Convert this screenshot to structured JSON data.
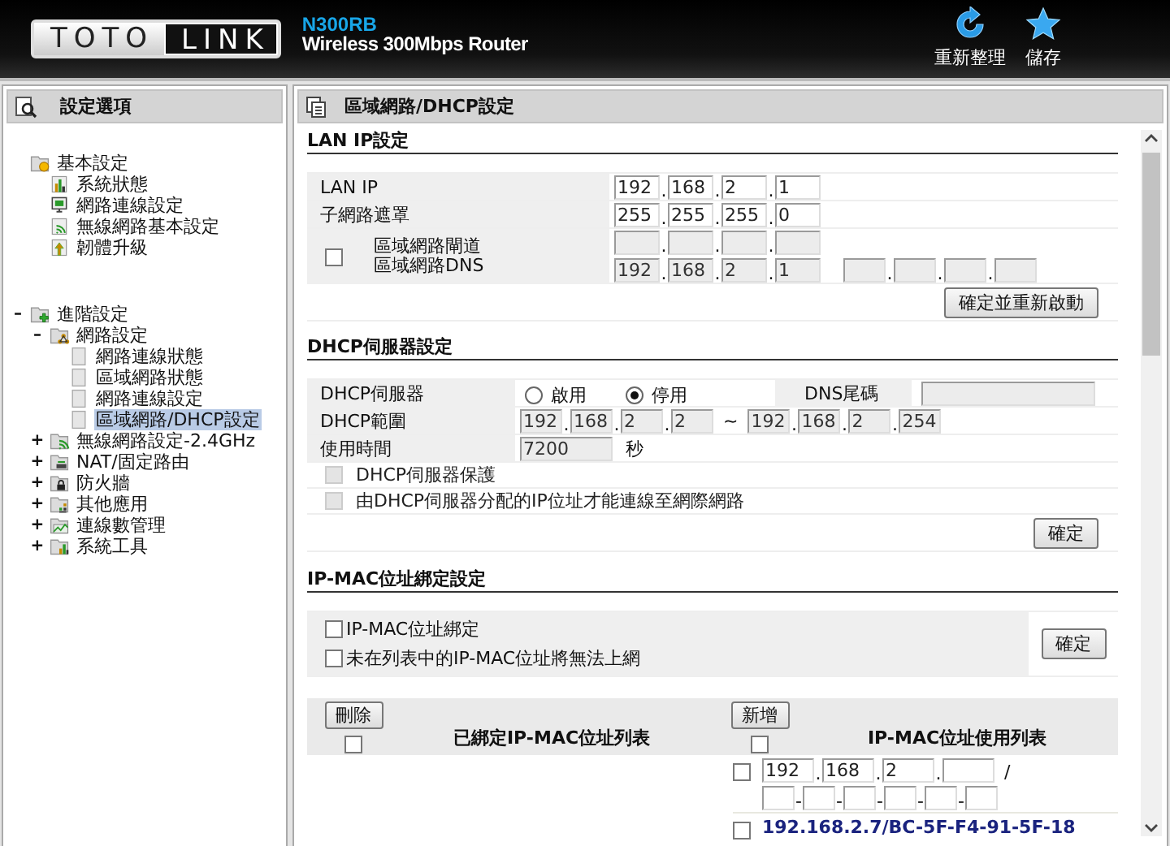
{
  "header": {
    "logo": {
      "left": "TOTO",
      "right": "LINK"
    },
    "model": "N300RB",
    "subtitle": "Wireless 300Mbps Router",
    "actions": [
      {
        "label": "重新整理",
        "kind": "refresh"
      },
      {
        "label": "儲存",
        "kind": "save"
      }
    ]
  },
  "sidebar": {
    "title": "設定選項",
    "items": [
      {
        "label": "基本設定",
        "kind": "basic-folder",
        "selected": false,
        "children": [
          {
            "label": "系統狀態",
            "kind": "status",
            "selected": false
          },
          {
            "label": "網路連線設定",
            "kind": "monitor",
            "selected": false
          },
          {
            "label": "無線網路基本設定",
            "kind": "wireless",
            "selected": false
          },
          {
            "label": "韌體升級",
            "kind": "upgrade",
            "selected": false
          }
        ]
      },
      {
        "label": "進階設定",
        "kind": "advanced-folder",
        "toggle": "–",
        "selected": false,
        "children": [
          {
            "label": "網路設定",
            "kind": "network-folder",
            "toggle": "–",
            "selected": false,
            "children": [
              {
                "label": "網路連線狀態",
                "kind": "page",
                "selected": false
              },
              {
                "label": "區域網路狀態",
                "kind": "page",
                "selected": false
              },
              {
                "label": "網路連線設定",
                "kind": "page",
                "selected": false
              },
              {
                "label": "區域網路/DHCP設定",
                "kind": "page",
                "selected": true
              }
            ]
          },
          {
            "label": "無線網路設定-2.4GHz",
            "kind": "wireless-folder",
            "toggle": "+",
            "selected": false
          },
          {
            "label": "NAT/固定路由",
            "kind": "nat-folder",
            "toggle": "+",
            "selected": false
          },
          {
            "label": "防火牆",
            "kind": "lock-folder",
            "toggle": "+",
            "selected": false
          },
          {
            "label": "其他應用",
            "kind": "apps-folder",
            "toggle": "+",
            "selected": false
          },
          {
            "label": "連線數管理",
            "kind": "graph-folder",
            "toggle": "+",
            "selected": false
          },
          {
            "label": "系統工具",
            "kind": "status-folder",
            "toggle": "+",
            "selected": false
          }
        ]
      }
    ]
  },
  "main": {
    "title": "區域網路/DHCP設定",
    "octet_separator": ".",
    "mac_separator": "-",
    "lan": {
      "heading": "LAN IP設定",
      "lan_ip": {
        "label": "LAN IP",
        "octets": [
          "192",
          "168",
          "2",
          "1"
        ],
        "disabled": false
      },
      "subnet": {
        "label": "子網路遮罩",
        "octets": [
          "255",
          "255",
          "255",
          "0"
        ],
        "disabled": false
      },
      "gateway": {
        "checked": false,
        "label": "區域網路閘道",
        "disabled": true
      },
      "dns": {
        "label": "區域網路DNS",
        "octets": [
          "192",
          "168",
          "2",
          "1"
        ],
        "disabled": true
      },
      "button": "確定並重新啟動"
    },
    "dhcp": {
      "heading": "DHCP伺服器設定",
      "server": {
        "label": "DHCP伺服器",
        "options": [
          {
            "label": "啟用",
            "selected": false
          },
          {
            "label": "停用",
            "selected": true
          }
        ]
      },
      "dns_suffix": {
        "label": "DNS尾碼",
        "disabled": true
      },
      "range": {
        "label": "DHCP範圍",
        "start": [
          "192",
          "168",
          "2",
          "2"
        ],
        "separator": "~",
        "end": [
          "192",
          "168",
          "2",
          "254"
        ],
        "disabled": true
      },
      "lease": {
        "label": "使用時間",
        "value": "7200",
        "unit": "秒",
        "disabled": true
      },
      "options": [
        {
          "label": "DHCP伺服器保護",
          "checked": false,
          "disabled": true
        },
        {
          "label": "由DHCP伺服器分配的IP位址才能連線至網際網路",
          "checked": false,
          "disabled": true
        }
      ],
      "button": "確定"
    },
    "binding": {
      "heading": "IP-MAC位址綁定設定",
      "options": [
        {
          "label": "IP-MAC位址綁定",
          "checked": false
        },
        {
          "label": "未在列表中的IP-MAC位址將無法上網",
          "checked": false
        }
      ],
      "button": "確定",
      "bound_list": {
        "button": "刪除",
        "title": "已綁定IP-MAC位址列表",
        "select_all": false
      },
      "usage_list": {
        "button": "新增",
        "title": "IP-MAC位址使用列表",
        "select_all": false,
        "new_entry": {
          "checked": false,
          "ip": [
            "192",
            "168",
            "2"
          ],
          "separator": "/"
        },
        "entries": [
          {
            "checked": false,
            "text": "192.168.2.7/BC-5F-F4-91-5F-18"
          }
        ]
      }
    }
  }
}
